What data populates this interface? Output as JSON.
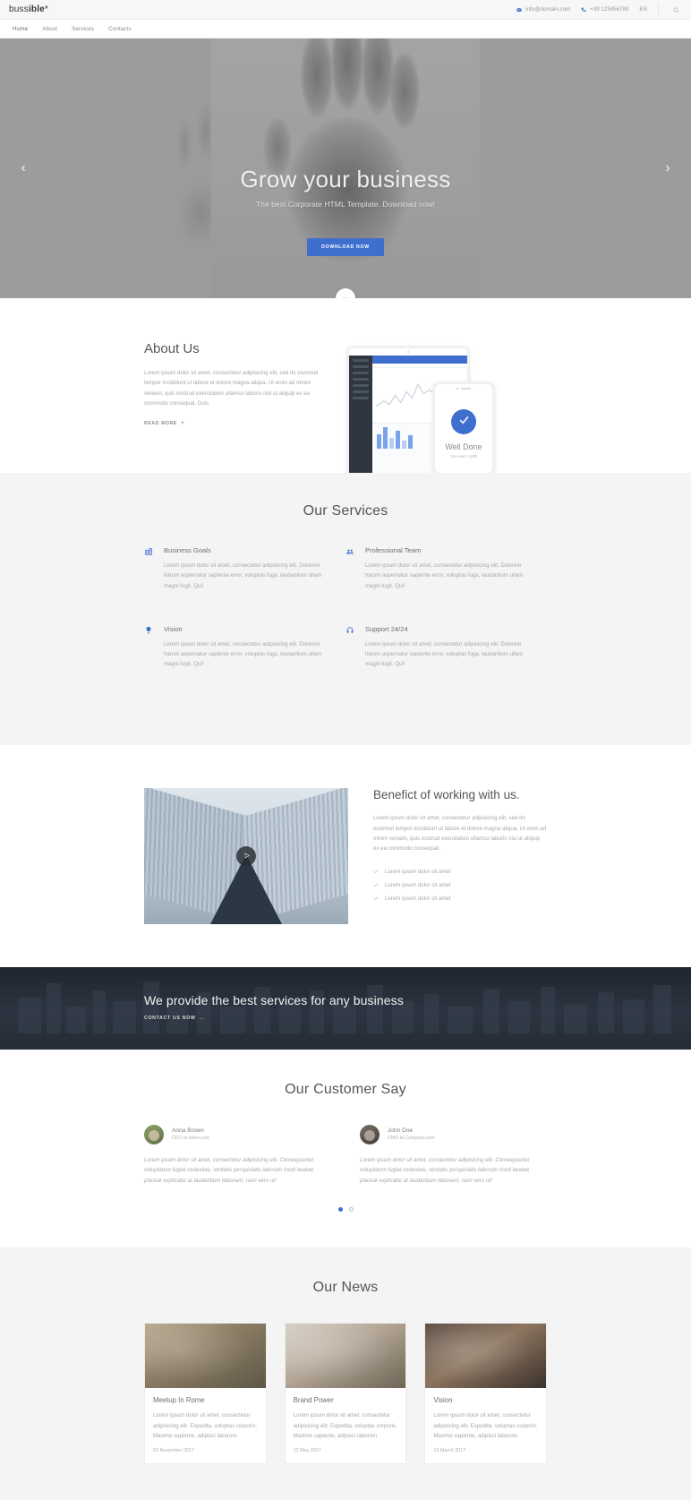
{
  "topbar": {
    "brand_pre": "buss",
    "brand_mid": "ible",
    "brand_star": "*",
    "email": "info@domain.com",
    "phone": "+39 123456789",
    "lang": "EN",
    "search_icon": "search-icon"
  },
  "nav": {
    "items": [
      {
        "label": "Home"
      },
      {
        "label": "About"
      },
      {
        "label": "Services"
      },
      {
        "label": "Contacts"
      }
    ]
  },
  "hero": {
    "title": "Grow your business",
    "subtitle": "The best Corporate HTML Template. Download now!",
    "button": "DOWNLOAD NOW",
    "prev_icon": "chevron-left-icon",
    "next_icon": "chevron-right-icon",
    "scroll_icon": "chevron-down-icon"
  },
  "about": {
    "heading": "About Us",
    "body": "Lorem ipsum dolor sit amet, consectetur adipisicing elit, sed do eiusmod tempor incididunt ut labore et dolore magna aliqua. Ut enim ad minim veniam, quis nostrud exercitation ullamco laboris nisi ut aliquip ex ea commodo consequat. Duis",
    "read_more": "READ MORE",
    "read_more_icon": "plus-icon",
    "phone_done": "Well Done",
    "phone_earn": "You earn 150$"
  },
  "services": {
    "title": "Our Services",
    "items": [
      {
        "icon": "building-icon",
        "title": "Business Goals",
        "body": "Lorem ipsum dolor sit amet, consectetur adipisicing elit. Dolorem harum aspernatur sapiente error, voluptas fuga, laudantium ullam magni fugit. Qui!"
      },
      {
        "icon": "people-icon",
        "title": "Professional Team",
        "body": "Lorem ipsum dolor sit amet, consectetur adipisicing elit. Dolorem harum aspernatur sapiente error, voluptas fuga, laudantium ullam magni fugit. Qui!"
      },
      {
        "icon": "lightbulb-icon",
        "title": "Vision",
        "body": "Lorem ipsum dolor sit amet, consectetur adipisicing elit. Dolorem harum aspernatur sapiente error, voluptas fuga, laudantium ullam magni fugit. Qui!"
      },
      {
        "icon": "headset-icon",
        "title": "Support 24/24",
        "body": "Lorem ipsum dolor sit amet, consectetur adipisicing elit. Dolorem harum aspernatur sapiente error, voluptas fuga, laudantium ullam magni fugit. Qui!"
      }
    ]
  },
  "benefit": {
    "heading": "Benefict of working with us.",
    "body": "Lorem ipsum dolor sit amet, consectetur adipisicing elit, sed do eiusmod tempor incididunt ut labore et dolore magna aliqua. Ut enim ad minim veniam, quis nostrud exercitation ullamco laboris nisi ut aliquip ex ea commodo consequat.",
    "play_icon": "play-icon",
    "list": [
      {
        "text": "Lorem ipsum dolor sit amet"
      },
      {
        "text": "Lorem ipsum dolor sit amet"
      },
      {
        "text": "Lorem ipsum dolor sit amet"
      }
    ]
  },
  "cta": {
    "heading": "We provide the best services for any business",
    "link": "CONTACT US NOW",
    "link_icon": "arrow-right-icon"
  },
  "testimonials": {
    "title": "Our Customer Say",
    "items": [
      {
        "name": "Anna Brown",
        "role": "CEO at index.com",
        "quote": "Lorem ipsum dolor sit amet, consectetur adipisicing elit. Consequuntur voluptatum fugiat molestias, veritatis perspiciatis laborum modi beatae placeat explicabo at laudantium laboriam, nam vero ut!"
      },
      {
        "name": "John Doe",
        "role": "CMO at Company.com",
        "quote": "Lorem ipsum dolor sit amet, consectetur adipisicing elit. Consequuntur voluptatum fugiat molestias, veritatis perspiciatis laborum modi beatae placeat explicabo at laudantium laboriam, nam vero ut!"
      }
    ],
    "dots": [
      {
        "active": true
      },
      {
        "active": false
      }
    ]
  },
  "news": {
    "title": "Our News",
    "items": [
      {
        "title": "Meetup In Rome",
        "body": "Lorem ipsum dolor sit amet, consectetur adipisicing elit. Expedita, voluptas corporis. Maxime sapiente, adipisci laborum.",
        "date": "02 November 2017"
      },
      {
        "title": "Brand Power",
        "body": "Lorem ipsum dolor sit amet, consectetur adipisicing elit. Expedita, voluptas corporis. Maxime sapiente, adipisci laborum.",
        "date": "12 May 2017"
      },
      {
        "title": "Vision",
        "body": "Lorem ipsum dolor sit amet, consectetur adipisicing elit. Expedita, voluptas corporis. Maxime sapiente, adipisci laborum.",
        "date": "13 March 2017"
      }
    ]
  },
  "colors": {
    "accent": "#3f6fce",
    "dark": "#2b3440",
    "muted": "#a8a8a8",
    "section_bg": "#f4f4f4"
  }
}
